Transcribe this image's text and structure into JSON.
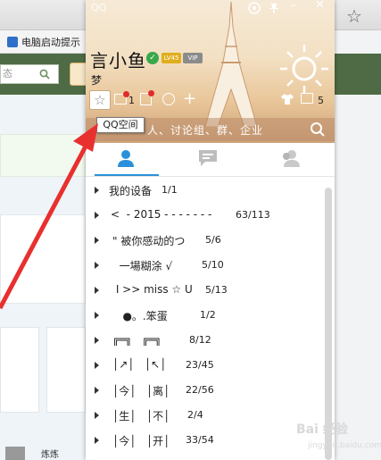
{
  "browser": {
    "bookmark_label": "电脑启动提示",
    "site_search_placeholder": "态",
    "user_name_partial": "炼炼"
  },
  "qq": {
    "logo": "QQ",
    "nickname": "言小鱼",
    "level_badge": "LV45",
    "vip_badge": "VIP",
    "signature": "梦",
    "mail_count": "1",
    "msg_count": "5",
    "tooltip": "QQ空间",
    "search_hint": "人、讨论组、群、企业",
    "tabs": [
      "contacts",
      "recent-chats",
      "groups"
    ]
  },
  "groups": [
    {
      "name": "我的设备",
      "count": "1/1"
    },
    {
      "name": "<  - 2015 - - - - - - -",
      "count": "63/113"
    },
    {
      "name": "\" 被你感动的つ",
      "count": "5/6"
    },
    {
      "name": "  一場糊涂 √",
      "count": "5/10"
    },
    {
      "name": " I >> miss ☆ U",
      "count": "5/13"
    },
    {
      "name": "   ●。.笨蛋",
      "count": "1/2"
    },
    {
      "name": "╔═╗   ╔═╗",
      "count": "8/12"
    },
    {
      "name": "│↗│   │↖│",
      "count": "23/45"
    },
    {
      "name": "│今│   │离│",
      "count": "22/56"
    },
    {
      "name": "│生│   │不│",
      "count": "2/4"
    },
    {
      "name": "│今│   │开│",
      "count": "33/54"
    }
  ],
  "watermark": {
    "text": "Bai 经验",
    "sub": "jingyan.baidu.com"
  },
  "colors": {
    "accent_blue": "#2b90d9",
    "online_green": "#38a84a",
    "alert_red": "#e02b2b",
    "annotation_red": "#e8302f"
  }
}
